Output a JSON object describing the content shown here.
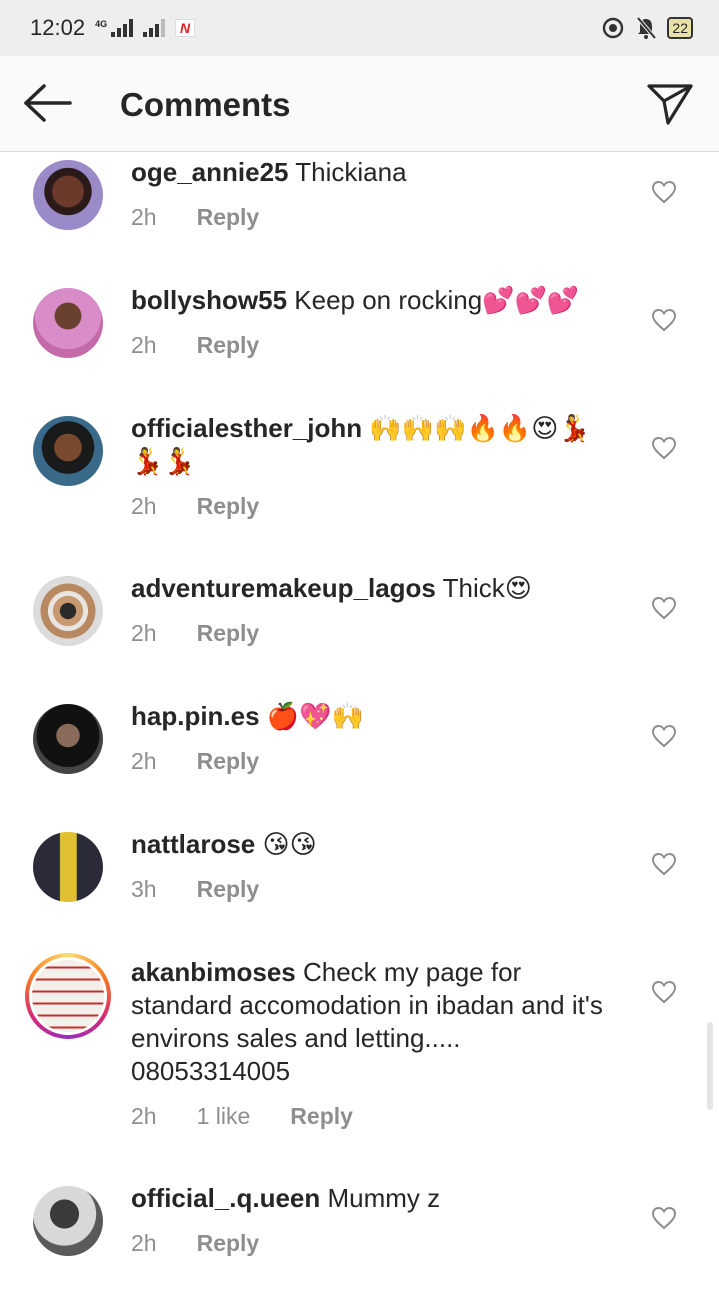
{
  "status": {
    "time": "12:02",
    "network": "4G",
    "battery": "22"
  },
  "header": {
    "title": "Comments"
  },
  "comments": [
    {
      "user": "oge_annie25",
      "text": "Thickiana",
      "time": "2h",
      "likes": "",
      "reply": "Reply"
    },
    {
      "user": "bollyshow55",
      "text": "Keep on rocking💕💕💕",
      "time": "2h",
      "likes": "",
      "reply": "Reply"
    },
    {
      "user": "officialesther_john",
      "text": "🙌🙌🙌🔥🔥😍💃💃💃",
      "time": "2h",
      "likes": "",
      "reply": "Reply"
    },
    {
      "user": "adventuremakeup_lagos",
      "text": "Thick😍",
      "time": "2h",
      "likes": "",
      "reply": "Reply"
    },
    {
      "user": "hap.pin.es",
      "text": "🍎💖🙌",
      "time": "2h",
      "likes": "",
      "reply": "Reply"
    },
    {
      "user": "nattlarose",
      "text": "😘😘",
      "time": "3h",
      "likes": "",
      "reply": "Reply"
    },
    {
      "user": "akanbimoses",
      "text": "Check my page for standard accomodation in ibadan and it's environs sales and letting..... 08053314005",
      "time": "2h",
      "likes": "1 like",
      "reply": "Reply"
    },
    {
      "user": "official_.q.ueen",
      "text": "Mummy z",
      "time": "2h",
      "likes": "",
      "reply": "Reply"
    }
  ],
  "colors": {
    "text": "#262626",
    "muted": "#8e8e8e",
    "header_bg": "#fafafa",
    "status_bg": "#eeeeee"
  }
}
